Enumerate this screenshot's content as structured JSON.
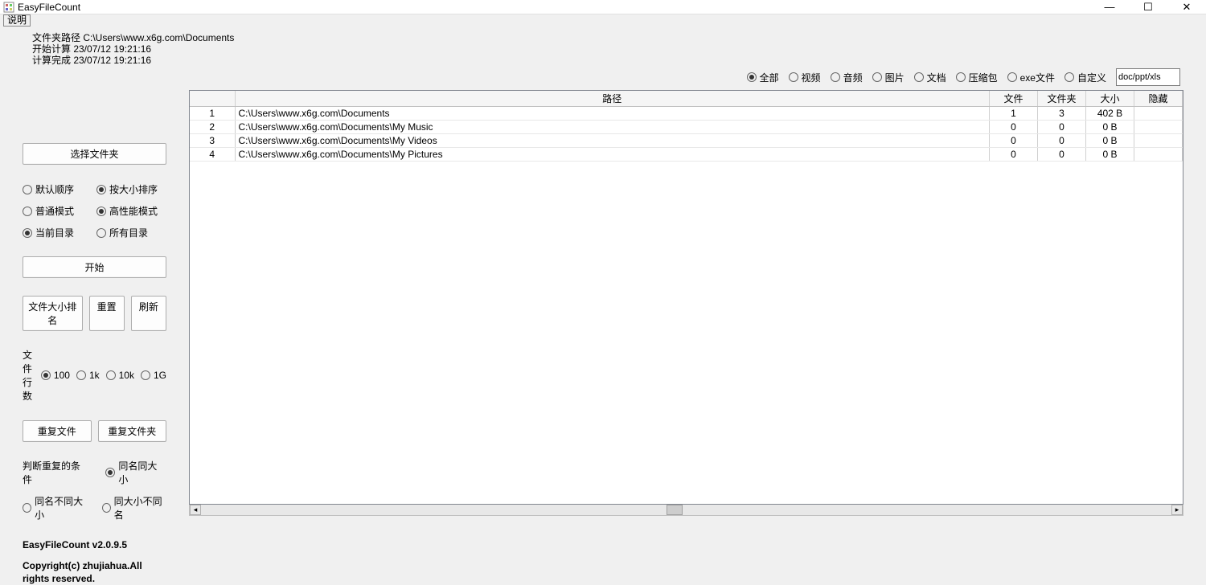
{
  "window": {
    "title": "EasyFileCount",
    "menu_help": "说明"
  },
  "info": {
    "line1": "文件夹路径 C:\\Users\\www.x6g.com\\Documents",
    "line2": "开始计算 23/07/12 19:21:16",
    "line3": "计算完成 23/07/12 19:21:16"
  },
  "sidebar": {
    "select_folder": "选择文件夹",
    "sort_default": "默认顺序",
    "sort_size": "按大小排序",
    "mode_normal": "普通模式",
    "mode_high": "高性能模式",
    "dir_current": "当前目录",
    "dir_all": "所有目录",
    "start": "开始",
    "file_size_sort": "文件大小排名",
    "reset": "重置",
    "refresh": "刷新",
    "rows_label": "文件行数",
    "rows_100": "100",
    "rows_1k": "1k",
    "rows_10k": "10k",
    "rows_1G": "1G",
    "dup_file": "重复文件",
    "dup_folder": "重复文件夹",
    "dup_cond_label": "判断重复的条件",
    "dup_same_name_size": "同名同大小",
    "dup_same_name_diff_size": "同名不同大小",
    "dup_same_size_diff_name": "同大小不同名",
    "version": "EasyFileCount v2.0.9.5",
    "copyright": "Copyright(c) zhujiahua.All rights reserved."
  },
  "filters": {
    "all": "全部",
    "video": "视频",
    "audio": "音频",
    "image": "图片",
    "doc": "文档",
    "archive": "压缩包",
    "exe": "exe文件",
    "custom": "自定义",
    "custom_value": "doc/ppt/xls"
  },
  "table": {
    "headers": {
      "idx": "",
      "path": "路径",
      "files": "文件",
      "folders": "文件夹",
      "size": "大小",
      "hidden": "隐藏"
    },
    "rows": [
      {
        "idx": "1",
        "path": "C:\\Users\\www.x6g.com\\Documents",
        "files": "1",
        "folders": "3",
        "size": "402 B",
        "hidden": ""
      },
      {
        "idx": "2",
        "path": "C:\\Users\\www.x6g.com\\Documents\\My Music",
        "files": "0",
        "folders": "0",
        "size": "0 B",
        "hidden": ""
      },
      {
        "idx": "3",
        "path": "C:\\Users\\www.x6g.com\\Documents\\My Videos",
        "files": "0",
        "folders": "0",
        "size": "0 B",
        "hidden": ""
      },
      {
        "idx": "4",
        "path": "C:\\Users\\www.x6g.com\\Documents\\My Pictures",
        "files": "0",
        "folders": "0",
        "size": "0 B",
        "hidden": ""
      }
    ]
  }
}
